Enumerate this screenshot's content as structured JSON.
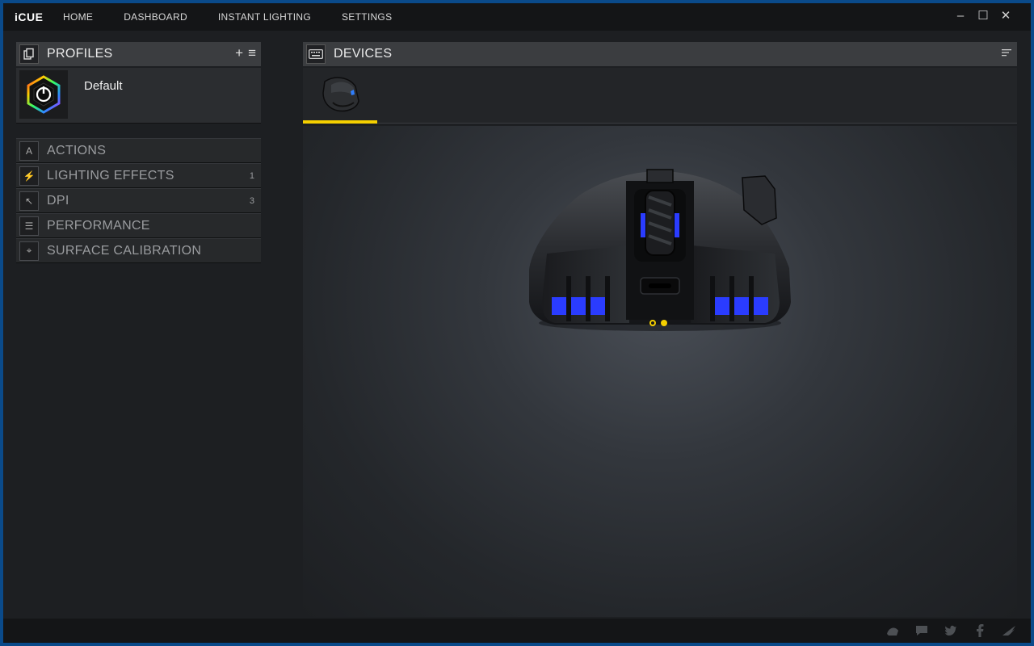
{
  "app": {
    "logo": "iCUE"
  },
  "nav": {
    "items": [
      {
        "label": "HOME"
      },
      {
        "label": "DASHBOARD"
      },
      {
        "label": "INSTANT LIGHTING"
      },
      {
        "label": "SETTINGS"
      }
    ]
  },
  "window_controls": {
    "minimize": "–",
    "maximize": "☐",
    "close": "✕"
  },
  "profiles": {
    "title": "PROFILES",
    "add_glyph": "+",
    "menu_glyph": "≡",
    "items": [
      {
        "name": "Default"
      }
    ]
  },
  "menu": {
    "items": [
      {
        "label": "ACTIONS",
        "icon": "letter-a-icon",
        "glyph": "A",
        "count": ""
      },
      {
        "label": "LIGHTING EFFECTS",
        "icon": "lightning-icon",
        "glyph": "⚡",
        "count": "1"
      },
      {
        "label": "DPI",
        "icon": "cursor-dpi-icon",
        "glyph": "↖",
        "count": "3"
      },
      {
        "label": "PERFORMANCE",
        "icon": "performance-toggles-icon",
        "glyph": "☰",
        "count": ""
      },
      {
        "label": "SURFACE CALIBRATION",
        "icon": "crosshair-icon",
        "glyph": "⌖",
        "count": ""
      }
    ]
  },
  "devices": {
    "title": "DEVICES",
    "selected_device_icon": "gaming-mouse-icon"
  },
  "pager": {
    "pages": 2,
    "active": 2
  },
  "colors": {
    "accent": "#f5d000",
    "led_blue": "#2a3cff",
    "background": "#1d1f22"
  },
  "footer_icons": [
    "community-icon",
    "chat-icon",
    "twitter-icon",
    "facebook-icon",
    "corsair-logo-icon"
  ]
}
